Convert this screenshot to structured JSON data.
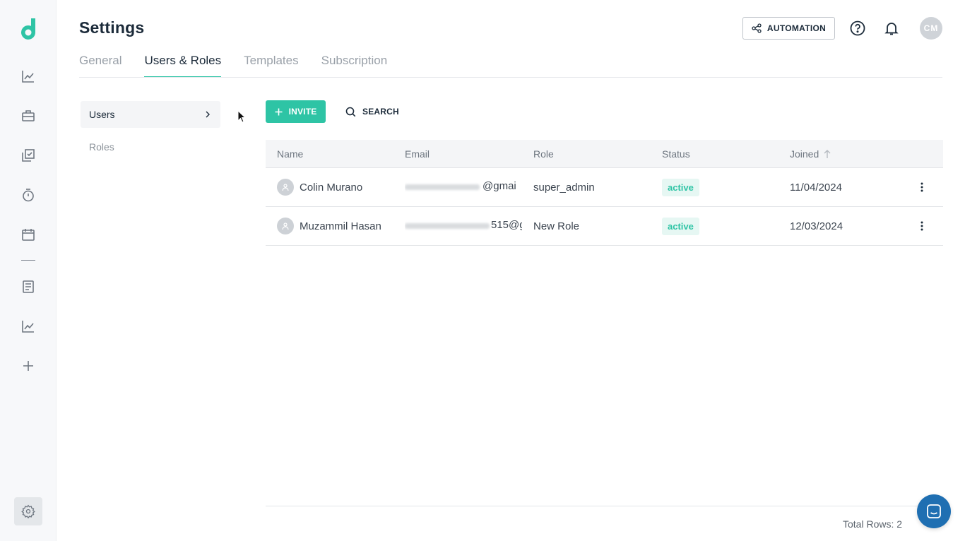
{
  "page": {
    "title": "Settings",
    "tabs": [
      {
        "label": "General",
        "active": false
      },
      {
        "label": "Users & Roles",
        "active": true
      },
      {
        "label": "Templates",
        "active": false
      },
      {
        "label": "Subscription",
        "active": false
      }
    ]
  },
  "header": {
    "automation_label": "AUTOMATION",
    "avatar_initials": "CM"
  },
  "sidebar_nav": [
    "chart-line-icon",
    "briefcase-icon",
    "tasks-icon",
    "stopwatch-icon",
    "calendar-icon",
    "document-icon",
    "chart-line-icon",
    "plus-icon",
    "gear-icon"
  ],
  "subnav": {
    "users_label": "Users",
    "roles_label": "Roles"
  },
  "toolbar": {
    "invite_label": "INVITE",
    "search_label": "SEARCH"
  },
  "table": {
    "columns": [
      "Name",
      "Email",
      "Role",
      "Status",
      "Joined"
    ],
    "rows": [
      {
        "name": "Colin Murano",
        "email_visible": "@gmai",
        "role": "super_admin",
        "status": "active",
        "joined": "11/04/2024"
      },
      {
        "name": "Muzammil Hasan",
        "email_visible": "515@g",
        "role": "New Role",
        "status": "active",
        "joined": "12/03/2024"
      }
    ],
    "sort": {
      "column": "Joined",
      "direction": "ascending"
    }
  },
  "footer": {
    "total_rows": "Total Rows: 2"
  },
  "colors": {
    "accent": "#2ec4a5",
    "chat": "#1f6fb2"
  }
}
